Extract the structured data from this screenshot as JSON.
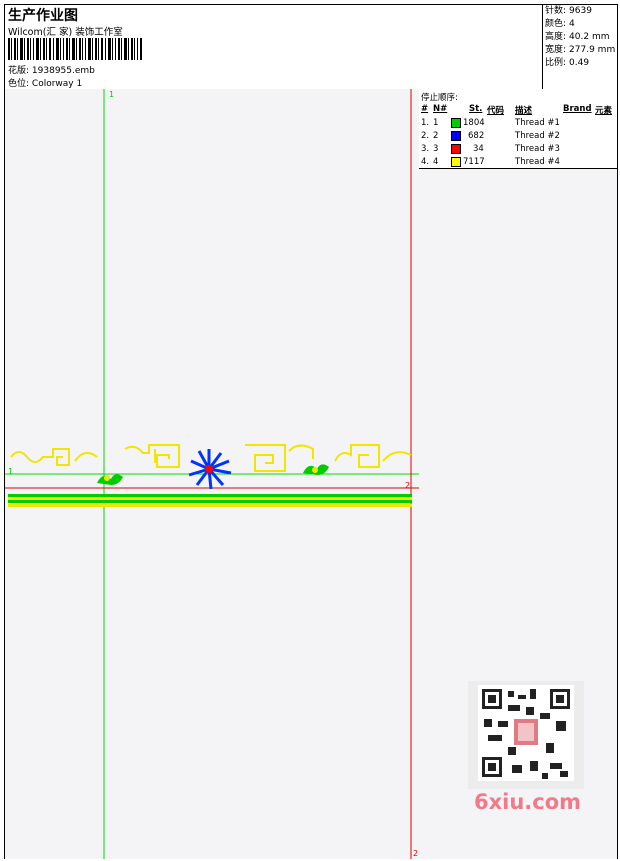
{
  "header": {
    "title": "生产作业图",
    "studio": "Wilcom(汇 家) 装饰工作室",
    "design": {
      "label": "花版:",
      "value": "1938955.emb"
    },
    "colorway": {
      "label": "色位:",
      "value": "Colorway 1"
    }
  },
  "stats": [
    {
      "label": "针数:",
      "value": "9639"
    },
    {
      "label": "颜色:",
      "value": "4"
    },
    {
      "label": "高度:",
      "value": "40.2 mm"
    },
    {
      "label": "宽度:",
      "value": "277.9 mm"
    },
    {
      "label": "比例:",
      "value": "0.49"
    }
  ],
  "stop_sequence": {
    "title": "停止顺序:",
    "columns": {
      "hash": "#",
      "no": "N#",
      "st": "St.",
      "code": "代码",
      "desc": "描述",
      "brand": "Brand",
      "element": "元素"
    },
    "rows": [
      {
        "num": "1.",
        "n": "1",
        "color": "#00cc00",
        "stitches": "1804",
        "desc": "Thread #1"
      },
      {
        "num": "2.",
        "n": "2",
        "color": "#0000ff",
        "stitches": "682",
        "desc": "Thread #2"
      },
      {
        "num": "3.",
        "n": "3",
        "color": "#ff0000",
        "stitches": "34",
        "desc": "Thread #3"
      },
      {
        "num": "4.",
        "n": "4",
        "color": "#ffff00",
        "stitches": "7117",
        "desc": "Thread #4"
      }
    ]
  },
  "markers": {
    "green_top": "1",
    "green_left": "1",
    "red_right": "2",
    "red_bottom": "2"
  },
  "watermark": "6xiu.com",
  "colors": {
    "green": "#00cc00",
    "red": "#dd0000",
    "yellow": "#f2e600",
    "blue": "#0033ff"
  }
}
